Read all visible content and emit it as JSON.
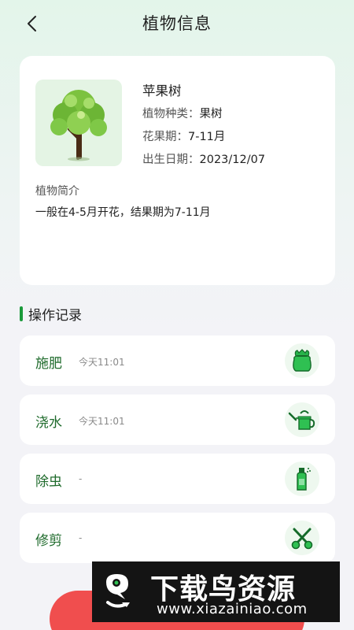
{
  "header": {
    "title": "植物信息",
    "back_icon": "chevron-left-icon"
  },
  "plant": {
    "name": "苹果树",
    "image_icon": "tree-icon",
    "type_label": "植物种类：",
    "type_value": "果树",
    "season_label": "花果期：",
    "season_value": "7-11月",
    "birth_label": "出生日期：",
    "birth_value": "2023/12/07",
    "intro_label": "植物简介",
    "intro_text": "一般在4-5月开花，结果期为7-11月"
  },
  "records": {
    "title": "操作记录",
    "items": [
      {
        "action": "施肥",
        "time": "今天11:01",
        "icon": "fertilizer-bag-icon"
      },
      {
        "action": "浇水",
        "time": "今天11:01",
        "icon": "watering-can-icon"
      },
      {
        "action": "除虫",
        "time": "-",
        "icon": "spray-bottle-icon"
      },
      {
        "action": "修剪",
        "time": "-",
        "icon": "scissors-icon"
      }
    ]
  },
  "watermark": {
    "name": "下载鸟资源",
    "url": "www.xiazainiao.com"
  },
  "colors": {
    "accent_green": "#1a9a3a",
    "action_text": "#1f6b2c",
    "cta_red": "#f04e4e"
  }
}
